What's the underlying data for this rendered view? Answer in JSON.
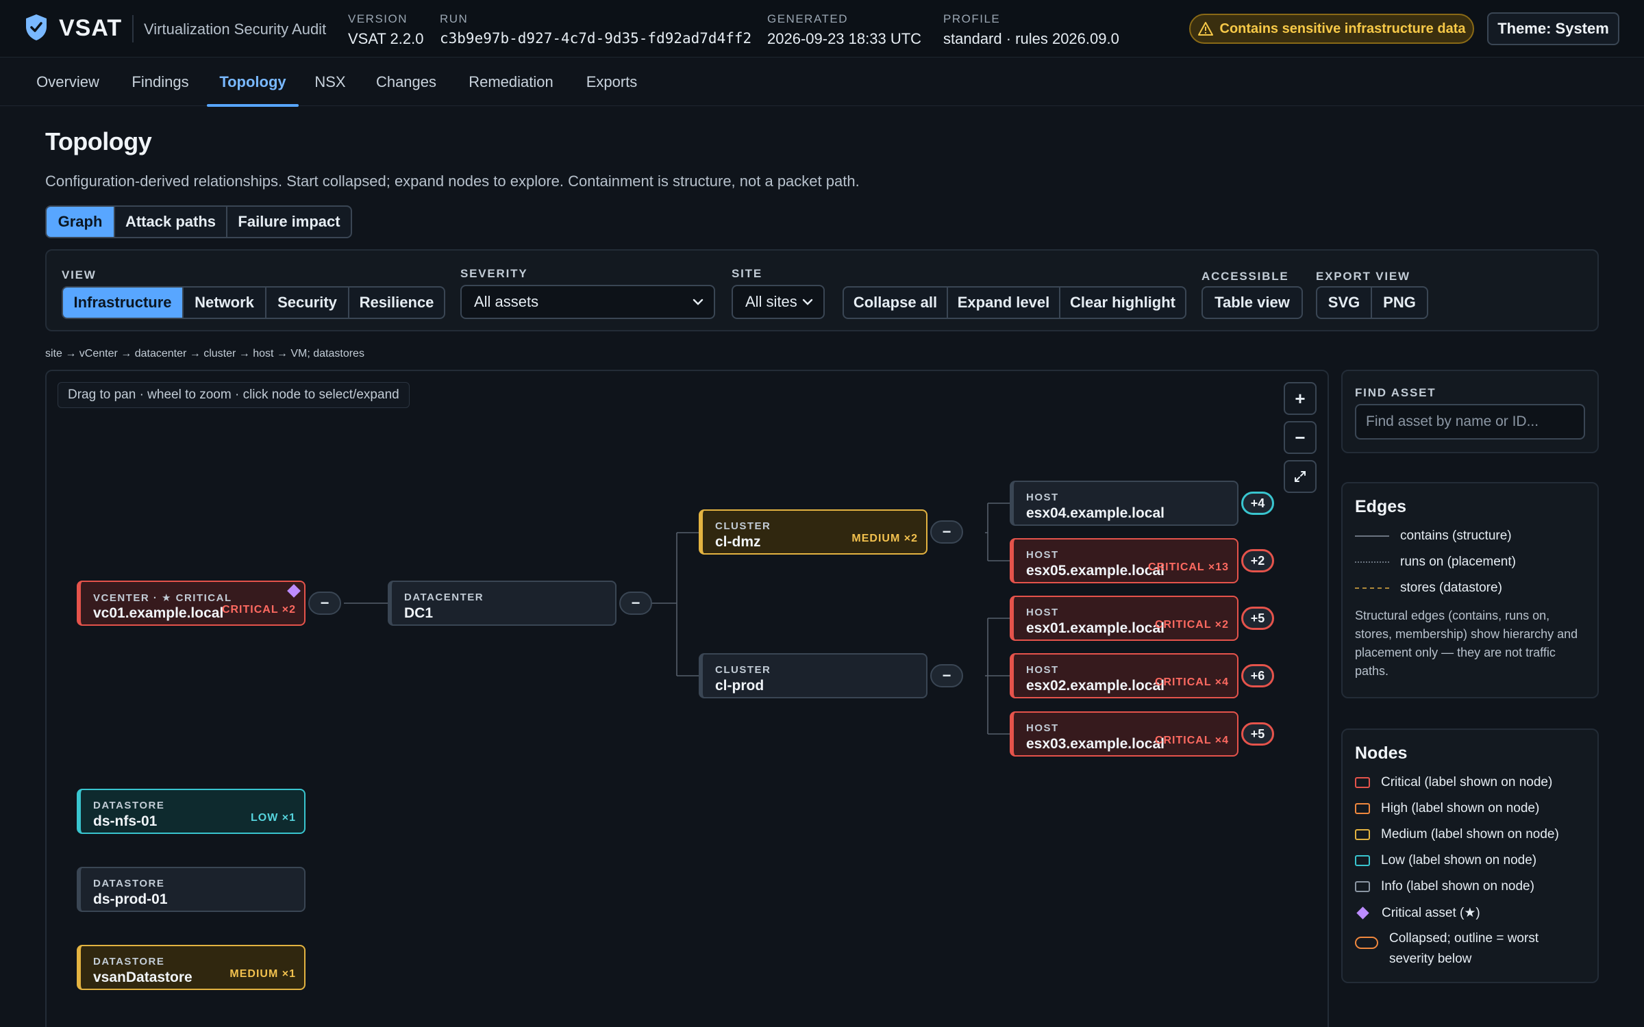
{
  "header": {
    "brand": "VSAT",
    "subtitle": "Virtualization Security Audit",
    "meta": [
      {
        "key": "VERSION",
        "value": "VSAT 2.2.0"
      },
      {
        "key": "RUN",
        "value": "c3b9e97b-d927-4c7d-9d35-fd92ad7d4ff2"
      },
      {
        "key": "GENERATED",
        "value": "2026-09-23 18:33 UTC"
      },
      {
        "key": "PROFILE",
        "value": "standard · rules 2026.09.0"
      }
    ],
    "warning": "Contains sensitive infrastructure data",
    "theme_button": "Theme: System"
  },
  "nav": {
    "tabs": [
      "Overview",
      "Findings",
      "Topology",
      "NSX",
      "Changes",
      "Remediation",
      "Exports"
    ],
    "active": "Topology"
  },
  "page": {
    "title": "Topology",
    "description": "Configuration-derived relationships. Start collapsed; expand nodes to explore. Containment is structure, not a packet path.",
    "modes": [
      "Graph",
      "Attack paths",
      "Failure impact"
    ],
    "active_mode": "Graph"
  },
  "toolbar": {
    "view_label": "VIEW",
    "views": [
      "Infrastructure",
      "Network",
      "Security",
      "Resilience"
    ],
    "active_view": "Infrastructure",
    "severity_label": "SEVERITY",
    "severity_value": "All assets",
    "site_label": "SITE",
    "site_value": "All sites",
    "actions": [
      "Collapse all",
      "Expand level",
      "Clear highlight"
    ],
    "accessible_label": "ACCESSIBLE",
    "table_view": "Table view",
    "export_label": "EXPORT VIEW",
    "exports": [
      "SVG",
      "PNG"
    ]
  },
  "breadcrumb": "site → vCenter → datacenter → cluster → host → VM; datastores",
  "canvas": {
    "hint": "Drag to pan · wheel to zoom · click node to select/expand",
    "zoom_in": "+",
    "zoom_out": "−",
    "fit_icon": "fit-screen-icon",
    "collapse_toggle": "−"
  },
  "nodes": {
    "vcenter": {
      "kind": "VCENTER · ★ CRITICAL",
      "name": "vc01.example.local",
      "sev": "CRITICAL ×2"
    },
    "datacenter": {
      "kind": "DATACENTER",
      "name": "DC1",
      "sev": ""
    },
    "cl_dmz": {
      "kind": "CLUSTER",
      "name": "cl-dmz",
      "sev": "MEDIUM ×2"
    },
    "cl_prod": {
      "kind": "CLUSTER",
      "name": "cl-prod",
      "sev": ""
    },
    "esx04": {
      "kind": "HOST",
      "name": "esx04.example.local",
      "sev": "",
      "more": "+4"
    },
    "esx05": {
      "kind": "HOST",
      "name": "esx05.example.local",
      "sev": "CRITICAL ×13",
      "more": "+2"
    },
    "esx01": {
      "kind": "HOST",
      "name": "esx01.example.local",
      "sev": "CRITICAL ×2",
      "more": "+5"
    },
    "esx02": {
      "kind": "HOST",
      "name": "esx02.example.local",
      "sev": "CRITICAL ×4",
      "more": "+6"
    },
    "esx03": {
      "kind": "HOST",
      "name": "esx03.example.local",
      "sev": "CRITICAL ×4",
      "more": "+5"
    },
    "ds_nfs": {
      "kind": "DATASTORE",
      "name": "ds-nfs-01",
      "sev": "LOW ×1"
    },
    "ds_prod": {
      "kind": "DATASTORE",
      "name": "ds-prod-01",
      "sev": ""
    },
    "vsan": {
      "kind": "DATASTORE",
      "name": "vsanDatastore",
      "sev": "MEDIUM ×1"
    }
  },
  "find": {
    "label": "FIND ASSET",
    "placeholder": "Find asset by name or ID..."
  },
  "edges_legend": {
    "title": "Edges",
    "items": [
      "contains (structure)",
      "runs on (placement)",
      "stores (datastore)"
    ],
    "note": "Structural edges (contains, runs on, stores, membership) show hierarchy and placement only — they are not traffic paths."
  },
  "nodes_legend": {
    "title": "Nodes",
    "items": [
      {
        "label": "Critical (label shown on node)",
        "color": "#e5534b"
      },
      {
        "label": "High (label shown on node)",
        "color": "#f0883e"
      },
      {
        "label": "Medium (label shown on node)",
        "color": "#e3b341"
      },
      {
        "label": "Low (label shown on node)",
        "color": "#39c5cf"
      },
      {
        "label": "Info (label shown on node)",
        "color": "#8b96a3"
      },
      {
        "label": "Critical asset (★)",
        "color": "#bc8cff"
      },
      {
        "label": "Collapsed; outline = worst severity below",
        "color": "#f0883e"
      }
    ]
  }
}
